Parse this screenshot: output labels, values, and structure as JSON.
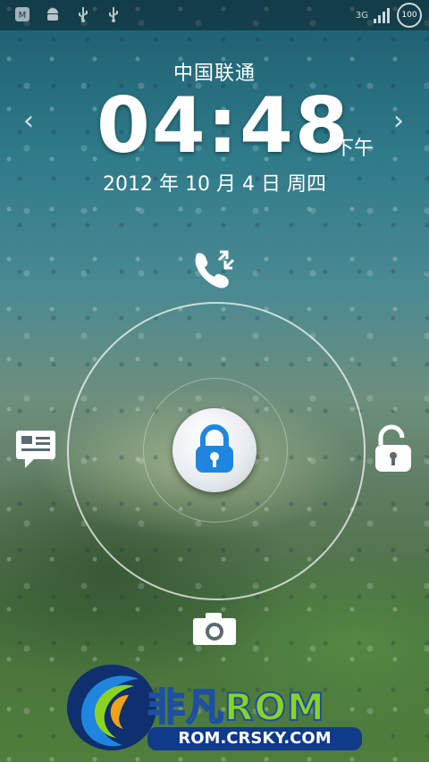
{
  "status_bar": {
    "icons_left": [
      "app-notification-icon",
      "android-debug-icon",
      "usb-icon",
      "usb-icon"
    ],
    "network_type": "3G",
    "battery_level": "100",
    "colors": {
      "icon": "#cfd8dc"
    }
  },
  "lockscreen": {
    "carrier": "中国联通",
    "time": "04:48",
    "ampm": "下午",
    "date": "2012 年 10 月 4 日 周四",
    "left_chevron": "‹",
    "right_chevron": "›",
    "targets": [
      {
        "name": "missed-call",
        "icon": "phone-call-icon"
      },
      {
        "name": "messages",
        "icon": "message-icon"
      },
      {
        "name": "unlock",
        "icon": "unlock-icon"
      },
      {
        "name": "camera",
        "icon": "camera-icon"
      }
    ],
    "lock_handle_icon": "lock-icon",
    "colors": {
      "lock_blue": "#1f86e0",
      "ring": "#ffffff"
    }
  },
  "watermark": {
    "title_part1": "非凡",
    "title_part2": "ROM",
    "url": "ROM.CRSKY.COM",
    "colors": {
      "accent_green": "#8bd321",
      "blue": "#1e4fa3"
    }
  }
}
